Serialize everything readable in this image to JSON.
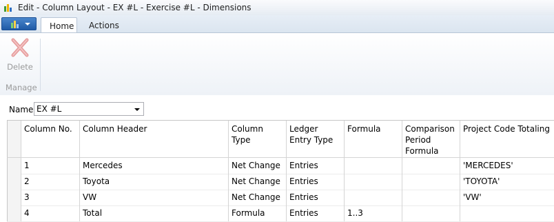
{
  "window": {
    "title": "Edit - Column Layout - EX #L - Exercise #L - Dimensions"
  },
  "ribbon": {
    "tabs": [
      {
        "label": "Home"
      },
      {
        "label": "Actions"
      }
    ],
    "delete_label": "Delete",
    "group_label": "Manage"
  },
  "form": {
    "name_label": "Name:",
    "name_value": "EX #L"
  },
  "grid": {
    "headers": [
      "Column No.",
      "Column Header",
      "Column Type",
      "Ledger Entry Type",
      "Formula",
      "Comparison Period Formula",
      "Project Code Totaling"
    ],
    "rows": [
      [
        "1",
        "Mercedes",
        "Net Change",
        "Entries",
        "",
        "",
        "'MERCEDES'"
      ],
      [
        "2",
        "Toyota",
        "Net Change",
        "Entries",
        "",
        "",
        "'TOYOTA'"
      ],
      [
        "3",
        "VW",
        "Net Change",
        "Entries",
        "",
        "",
        "'VW'"
      ],
      [
        "4",
        "Total",
        "Formula",
        "Entries",
        "1..3",
        "",
        ""
      ]
    ]
  },
  "colors": {
    "accent": "#1f5aa6",
    "disabled_text": "#9a9a9a",
    "delete_icon": "#e59a9a"
  }
}
